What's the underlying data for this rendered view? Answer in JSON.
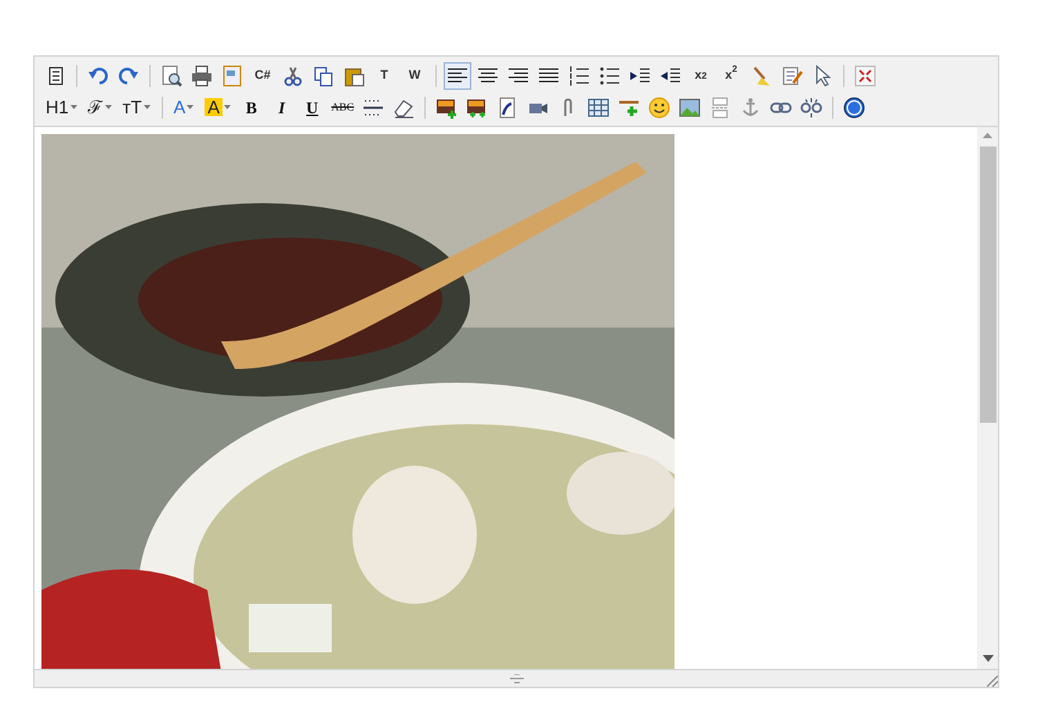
{
  "toolbar": {
    "rows": [
      [
        {
          "kind": "icon",
          "selected": false
        },
        {
          "kind": "sep"
        },
        {
          "kind": "icon",
          "selected": false
        },
        {
          "kind": "icon",
          "selected": false
        },
        {
          "kind": "sep"
        },
        {
          "kind": "icon",
          "selected": false
        },
        {
          "kind": "icon",
          "selected": false
        },
        {
          "kind": "icon",
          "selected": false
        },
        {
          "kind": "text",
          "label": "C#"
        },
        {
          "kind": "icon",
          "selected": false
        },
        {
          "kind": "icon",
          "selected": false
        },
        {
          "kind": "icon",
          "selected": false
        },
        {
          "kind": "text",
          "label": "T"
        },
        {
          "kind": "text",
          "label": "W"
        },
        {
          "kind": "sep"
        },
        {
          "kind": "icon",
          "selected": true
        },
        {
          "kind": "icon",
          "selected": false
        },
        {
          "kind": "icon",
          "selected": false
        },
        {
          "kind": "icon",
          "selected": false
        },
        {
          "kind": "icon",
          "selected": false
        },
        {
          "kind": "icon",
          "selected": false
        },
        {
          "kind": "icon",
          "selected": false
        },
        {
          "kind": "icon",
          "selected": false
        },
        {
          "kind": "text",
          "label": "x$_{2}$"
        },
        {
          "kind": "text",
          "label": "x$^{2}$"
        },
        {
          "kind": "icon",
          "selected": false
        },
        {
          "kind": "icon",
          "selected": false
        },
        {
          "kind": "icon",
          "selected": false
        },
        {
          "kind": "sep"
        },
        {
          "kind": "icon",
          "selected": false
        }
      ],
      [
        {
          "kind": "dropdown",
          "label": "H1"
        },
        {
          "kind": "dropdown",
          "label": "ℱ"
        },
        {
          "kind": "dropdown",
          "label": "тT"
        },
        {
          "kind": "sep"
        },
        {
          "kind": "dropdown",
          "label": "A"
        },
        {
          "kind": "highlight",
          "label": "A"
        },
        {
          "kind": "bold",
          "label": "B"
        },
        {
          "kind": "italic",
          "label": "I"
        },
        {
          "kind": "underline",
          "label": "U"
        },
        {
          "kind": "strike",
          "label": "ABC"
        },
        {
          "kind": "icon",
          "selected": false
        },
        {
          "kind": "icon",
          "selected": false
        },
        {
          "kind": "sep"
        },
        {
          "kind": "icon",
          "selected": false
        },
        {
          "kind": "icon",
          "selected": false
        },
        {
          "kind": "icon",
          "selected": false
        },
        {
          "kind": "icon",
          "selected": false
        },
        {
          "kind": "icon",
          "selected": false
        },
        {
          "kind": "icon",
          "selected": false
        },
        {
          "kind": "icon",
          "selected": false
        },
        {
          "kind": "icon",
          "selected": false
        },
        {
          "kind": "icon",
          "selected": false
        },
        {
          "kind": "icon",
          "selected": false
        },
        {
          "kind": "icon",
          "selected": false
        },
        {
          "kind": "icon",
          "selected": false
        },
        {
          "kind": "icon",
          "selected": false
        },
        {
          "kind": "sep"
        },
        {
          "kind": "icon",
          "selected": false
        }
      ]
    ]
  }
}
